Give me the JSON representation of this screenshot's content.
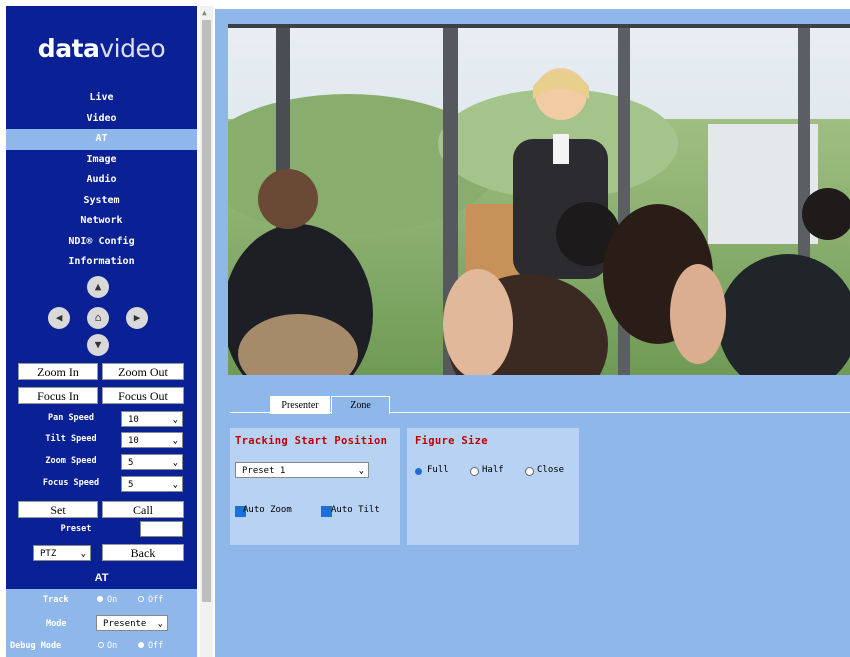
{
  "sidebar": {
    "logo_bold": "data",
    "logo_light": "video",
    "nav": [
      "Live",
      "Video",
      "AT",
      "Image",
      "Audio",
      "System",
      "Network",
      "NDI® Config",
      "Information"
    ],
    "active_nav": "AT",
    "zoom_in": "Zoom In",
    "zoom_out": "Zoom Out",
    "focus_in": "Focus In",
    "focus_out": "Focus Out",
    "pan_speed_label": "Pan Speed",
    "pan_speed": "10",
    "tilt_speed_label": "Tilt Speed",
    "tilt_speed": "10",
    "zoom_speed_label": "Zoom Speed",
    "zoom_speed": "5",
    "focus_speed_label": "Focus Speed",
    "focus_speed": "5",
    "set": "Set",
    "call": "Call",
    "preset_label": "Preset",
    "preset_value": "",
    "mode_select": "PTZ",
    "back": "Back",
    "at_title": "AT",
    "track_label": "Track",
    "track_on": "On",
    "track_off": "Off",
    "mode_label": "Mode",
    "mode_value": "Presente",
    "debug_label": "Debug Mode",
    "debug_on": "On",
    "debug_off": "Off"
  },
  "tabs": [
    "Presenter",
    "Zone"
  ],
  "active_tab": "Presenter",
  "tracking": {
    "title": "Tracking Start Position",
    "preset": "Preset 1",
    "auto_zoom": "Auto Zoom",
    "auto_tilt": "Auto Tilt"
  },
  "figure": {
    "title": "Figure Size",
    "options": [
      "Full",
      "Half",
      "Close"
    ],
    "selected": "Full"
  },
  "colors": {
    "sidebar_bg": "#0a2196",
    "accent": "#8fb7ea",
    "card": "#b7d2f2",
    "title_red": "#c00000"
  }
}
